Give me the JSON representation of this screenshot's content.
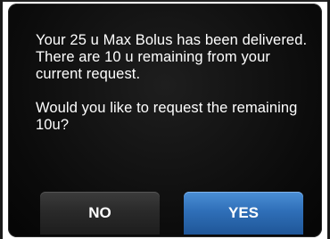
{
  "dialog": {
    "message": "Your 25 u Max Bolus has been delivered. There are 10 u remaining from your current request.",
    "question": "Would you like to request the remaining 10u?"
  },
  "buttons": {
    "no_label": "NO",
    "yes_label": "YES"
  },
  "colors": {
    "screen_background": "#0b0b0b",
    "text": "#ffffff",
    "no_button": "#2a2a2a",
    "yes_button": "#2f6fb8"
  }
}
